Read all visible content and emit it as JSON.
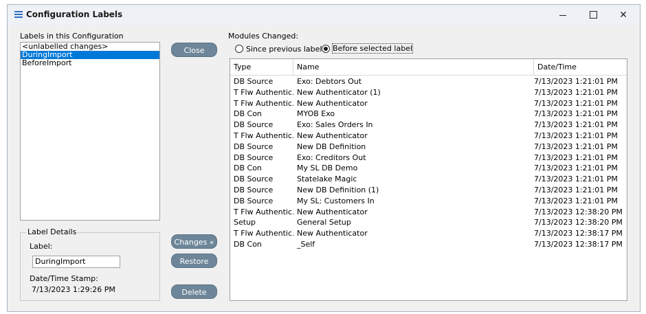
{
  "window": {
    "title": "Configuration Labels",
    "minimize_glyph": "",
    "close_glyph": "✕"
  },
  "labels_panel": {
    "heading": "Labels in this Configuration",
    "items": [
      {
        "label": "<unlabelled changes>",
        "selected": false
      },
      {
        "label": "DuringImport",
        "selected": true
      },
      {
        "label": "BeforeImport",
        "selected": false
      }
    ]
  },
  "buttons": {
    "close": "Close",
    "changes": "Changes «",
    "restore": "Restore",
    "delete": "Delete"
  },
  "label_details": {
    "legend": "Label Details",
    "label_caption": "Label:",
    "label_value": "DuringImport",
    "timestamp_caption": "Date/Time Stamp:",
    "timestamp_value": "7/13/2023 1:29:26 PM"
  },
  "modules": {
    "heading": "Modules Changed:",
    "options": [
      {
        "label": "Since previous label",
        "checked": false
      },
      {
        "label": "Before selected label",
        "checked": true
      }
    ],
    "columns": [
      "Type",
      "Name",
      "Date/Time"
    ],
    "rows": [
      {
        "type": "DB Source",
        "name": "Exo: Debtors Out",
        "datetime": "7/13/2023 1:21:01 PM"
      },
      {
        "type": "T Flw Authenticator",
        "name": "New Authenticator (1)",
        "datetime": "7/13/2023 1:21:01 PM"
      },
      {
        "type": "T Flw Authenticator",
        "name": "New Authenticator",
        "datetime": "7/13/2023 1:21:01 PM"
      },
      {
        "type": "DB Con",
        "name": "MYOB Exo",
        "datetime": "7/13/2023 1:21:01 PM"
      },
      {
        "type": "DB Source",
        "name": "Exo: Sales Orders In",
        "datetime": "7/13/2023 1:21:01 PM"
      },
      {
        "type": "T Flw Authenticator",
        "name": "New Authenticator",
        "datetime": "7/13/2023 1:21:01 PM"
      },
      {
        "type": "DB Source",
        "name": "New DB Definition",
        "datetime": "7/13/2023 1:21:01 PM"
      },
      {
        "type": "DB Source",
        "name": "Exo: Creditors Out",
        "datetime": "7/13/2023 1:21:01 PM"
      },
      {
        "type": "DB Con",
        "name": "My SL DB Demo",
        "datetime": "7/13/2023 1:21:01 PM"
      },
      {
        "type": "DB Source",
        "name": "Statelake Magic",
        "datetime": "7/13/2023 1:21:01 PM"
      },
      {
        "type": "DB Source",
        "name": "New DB Definition (1)",
        "datetime": "7/13/2023 1:21:01 PM"
      },
      {
        "type": "DB Source",
        "name": "My SL: Customers In",
        "datetime": "7/13/2023 1:21:01 PM"
      },
      {
        "type": "T Flw Authenticator",
        "name": "New Authenticator",
        "datetime": "7/13/2023 12:38:20 PM"
      },
      {
        "type": "Setup",
        "name": "General Setup",
        "datetime": "7/13/2023 12:38:20 PM"
      },
      {
        "type": "T Flw Authenticator",
        "name": "New Authenticator",
        "datetime": "7/13/2023 12:38:17 PM"
      },
      {
        "type": "DB Con",
        "name": "_Self",
        "datetime": "7/13/2023 12:38:17 PM"
      }
    ]
  },
  "colors": {
    "selection": "#0078d7",
    "button": "#6d8699",
    "title_icon": "#2d6cc0"
  }
}
